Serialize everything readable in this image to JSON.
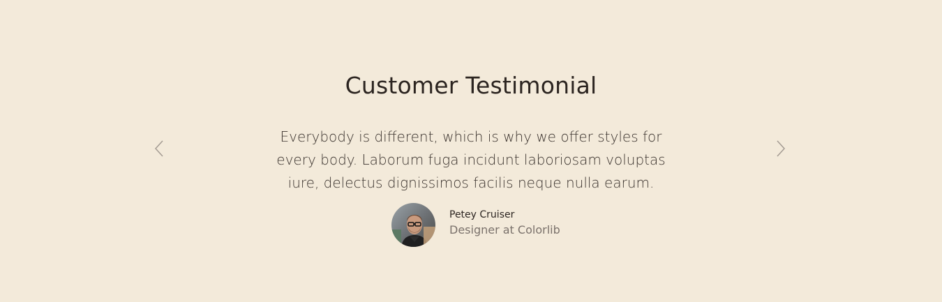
{
  "section": {
    "title": "Customer Testimonial",
    "quote": "Everybody is different, which is why we offer styles for every body. Laborum fuga incidunt laboriosam voluptas iure, delectus dignissimos facilis neque nulla earum."
  },
  "author": {
    "name": "Petey Cruiser",
    "role": "Designer at Colorlib"
  },
  "icons": {
    "prev": "chevron-left-icon",
    "next": "chevron-right-icon"
  },
  "colors": {
    "background": "#f3eada",
    "text": "#2b2420",
    "muted": "#7a716b",
    "arrow": "#a39b92"
  }
}
